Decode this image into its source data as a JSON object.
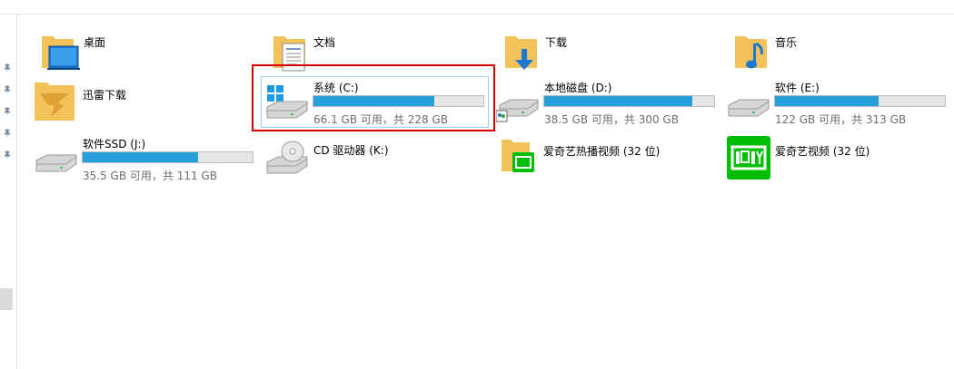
{
  "folders": [
    {
      "id": "desktop",
      "label": "桌面",
      "icon": "desktop-folder-icon"
    },
    {
      "id": "documents",
      "label": "文档",
      "icon": "documents-folder-icon"
    },
    {
      "id": "downloads",
      "label": "下载",
      "icon": "downloads-folder-icon"
    },
    {
      "id": "music",
      "label": "音乐",
      "icon": "music-folder-icon"
    },
    {
      "id": "xunlei",
      "label": "迅雷下载",
      "icon": "xunlei-folder-icon"
    }
  ],
  "drives": [
    {
      "id": "c",
      "label": "系统 (C:)",
      "info": "66.1 GB 可用，共 228 GB",
      "used_fraction": 0.71,
      "icon": "windows-drive-icon"
    },
    {
      "id": "d",
      "label": "本地磁盘 (D:)",
      "info": "38.5 GB 可用，共 300 GB",
      "used_fraction": 0.87,
      "icon": "network-drive-icon"
    },
    {
      "id": "e",
      "label": "软件 (E:)",
      "info": "122 GB 可用，共 313 GB",
      "used_fraction": 0.61,
      "icon": "drive-icon"
    },
    {
      "id": "j",
      "label": "软件SSD (J:)",
      "info": "35.5 GB 可用，共 111 GB",
      "used_fraction": 0.68,
      "icon": "drive-icon"
    },
    {
      "id": "k",
      "label": "CD 驱动器 (K:)",
      "icon": "cd-drive-icon"
    }
  ],
  "apps": [
    {
      "id": "iqiyi-hot",
      "label": "爱奇艺热播视频 (32 位)",
      "icon": "iqiyi-folder-icon"
    },
    {
      "id": "iqiyi",
      "label": "爱奇艺视频 (32 位)",
      "icon": "iqiyi-app-icon"
    }
  ],
  "colors": {
    "accent": "#26a0da",
    "selection_border": "#d40000",
    "folder": "#f4c25b",
    "iqiyi_green": "#00be06"
  }
}
